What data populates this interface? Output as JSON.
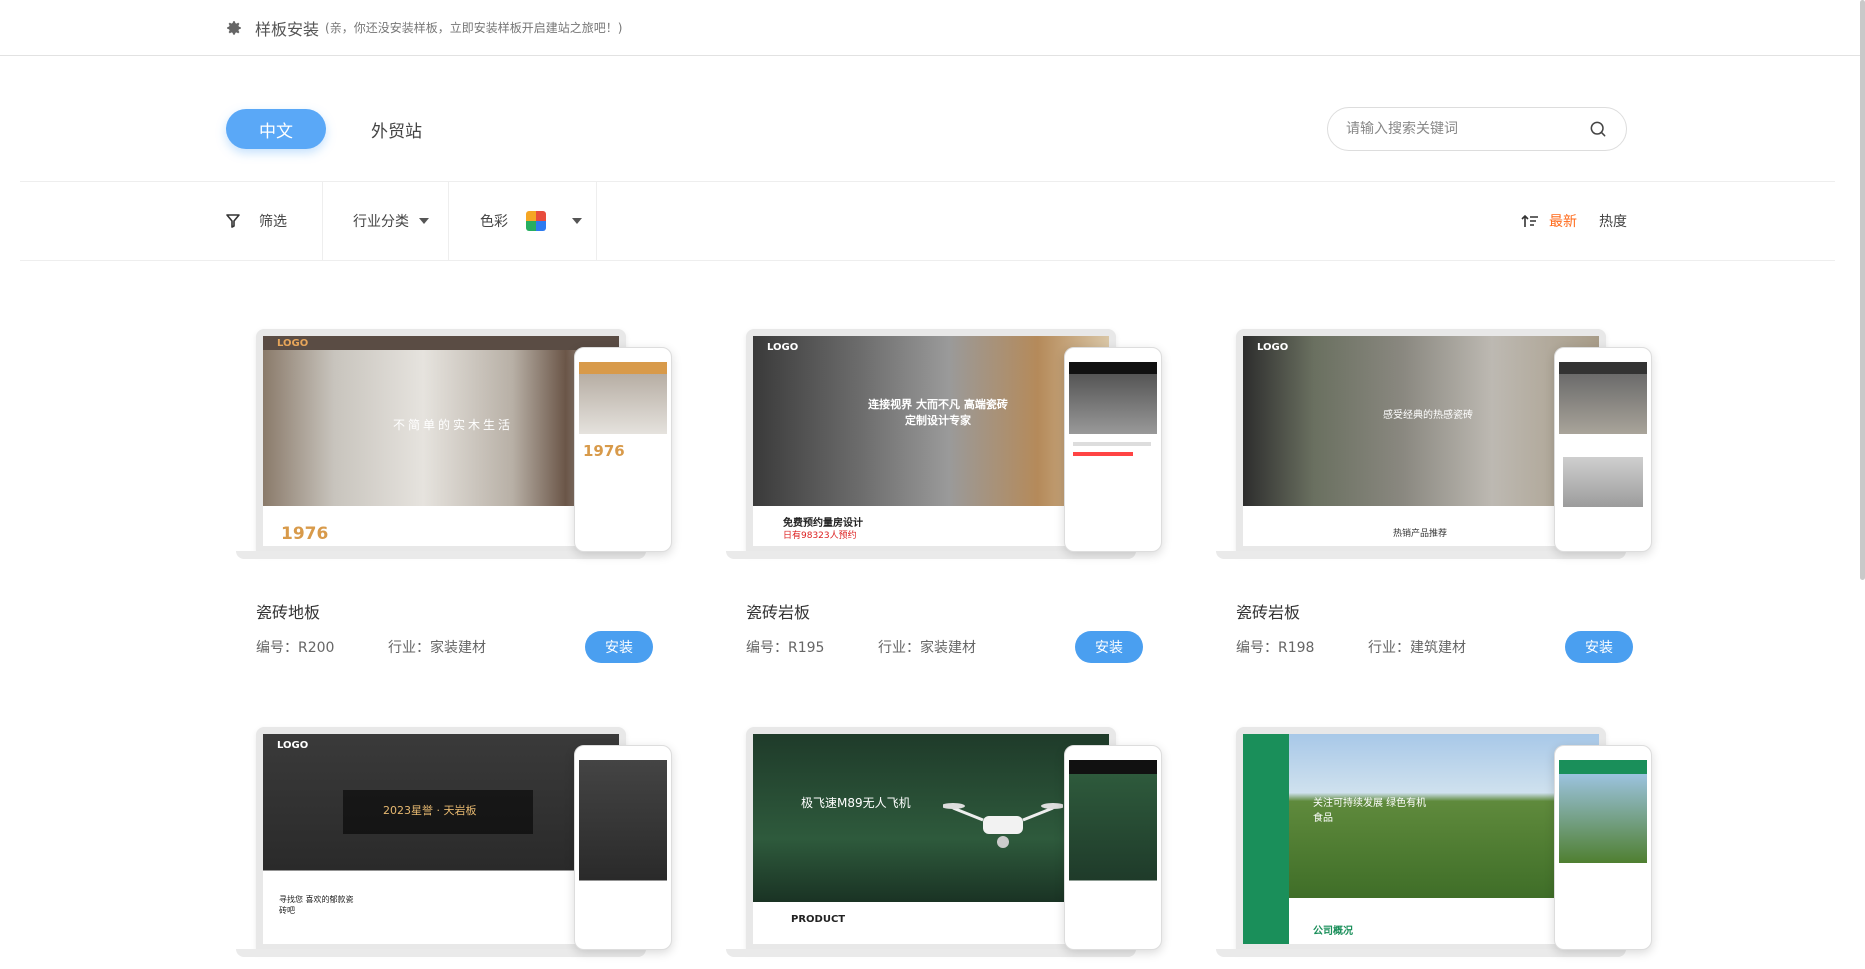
{
  "header": {
    "title": "样板安装",
    "hint": "(亲，你还没安装样板，立即安装样板开启建站之旅吧！)"
  },
  "tabs": [
    {
      "label": "中文",
      "active": true
    },
    {
      "label": "外贸站",
      "active": false
    }
  ],
  "search": {
    "placeholder": "请输入搜索关键词"
  },
  "filters": {
    "filter_label": "筛选",
    "industry_label": "行业分类",
    "color_label": "色彩",
    "sort_newest": "最新",
    "sort_popular": "热度"
  },
  "colors": {
    "accent": "#5aa8f7",
    "install_button": "#4a9ff0",
    "sort_active": "#ff6a1a"
  },
  "templates": [
    {
      "name": "瓷砖地板",
      "code": "编号：R200",
      "industry": "行业：家装建材",
      "install_label": "安装",
      "preview": {
        "logo": "LOGO",
        "hero": "不简单的实木生活",
        "stat": "1976"
      }
    },
    {
      "name": "瓷砖岩板",
      "code": "编号：R195",
      "industry": "行业：家装建材",
      "install_label": "安装",
      "preview": {
        "logo": "LOGO",
        "hero": "连接视界 大而不凡 高端瓷砖定制设计专家",
        "stat": "免费预约量房设计"
      }
    },
    {
      "name": "瓷砖岩板",
      "code": "编号：R198",
      "industry": "行业：建筑建材",
      "install_label": "安装",
      "preview": {
        "logo": "LOGO",
        "hero": "感受经典的热感瓷砖",
        "stat": "热销产品推荐"
      }
    },
    {
      "name": "",
      "code": "",
      "industry": "",
      "install_label": "",
      "preview": {
        "logo": "LOGO",
        "hero": "2023星誉 · 天岩板",
        "stat": "寻找您 喜欢的郁款瓷砖吧"
      }
    },
    {
      "name": "",
      "code": "",
      "industry": "",
      "install_label": "",
      "preview": {
        "logo": "",
        "hero": "极飞速M89无人飞机",
        "stat": "PRODUCT"
      }
    },
    {
      "name": "",
      "code": "",
      "industry": "",
      "install_label": "",
      "preview": {
        "logo": "",
        "hero": "关注可持续发展 绿色有机食品",
        "stat": "公司概况"
      }
    }
  ]
}
